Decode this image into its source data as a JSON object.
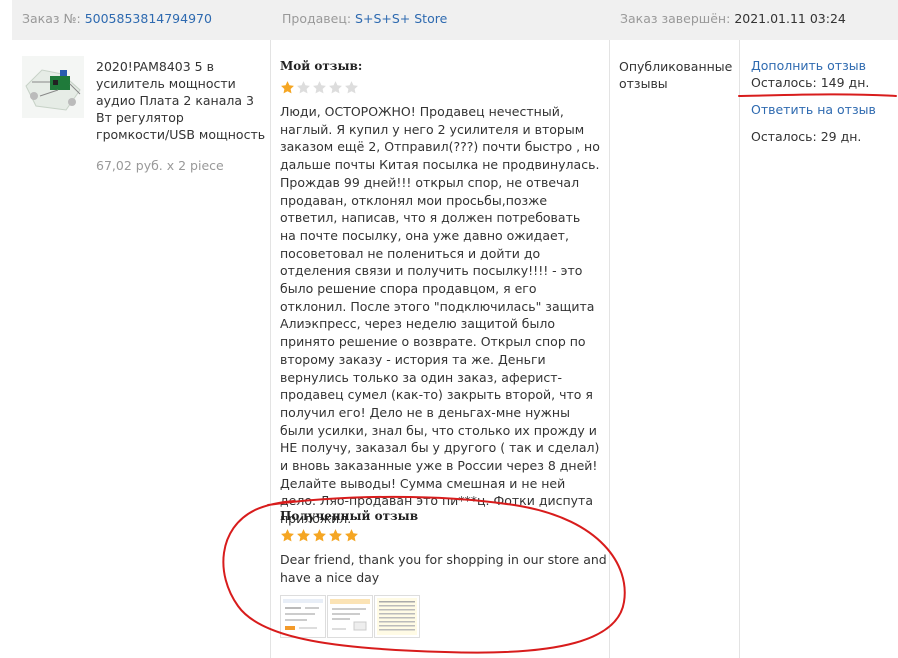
{
  "header": {
    "order_label": "Заказ №:",
    "order_number": "5005853814794970",
    "seller_label": "Продавец:",
    "seller_name": "S+S+S+ Store",
    "completed_label": "Заказ завершён:",
    "completed_date": "2021.01.11 03:24"
  },
  "product": {
    "title": "2020!PAM8403 5 в усилитель мощности аудио Плата 2 канала 3 Вт регулятор громкости/USB мощность",
    "price": "67,02 руб. x 2 piece"
  },
  "my_review": {
    "heading": "Мой отзыв:",
    "rating": 1,
    "max_rating": 5,
    "text": "Люди, ОСТОРОЖНО! Продавец нечестный, наглый. Я купил у него 2 усилителя и вторым заказом ещё 2, Отправил(???) почти быстро , но дальше почты Китая посылка не продвинулась. Прождав 99 дней!!! открыл спор, не отвечал продаван, отклонял мои просьбы,позже ответил, написав, что я должен потребовать на почте посылку, она уже давно ожидает, посоветовал не полениться и дойти до отделения связи и получить посылку!!!! - это было решение спора продавцом, я его отклонил. После этого \"подключилась\" защита Алиэкпресс, через неделю защитой было принято решение о возврате. Открыл спор по второму заказу - история та же. Деньги вернулись только за один заказ, аферист-продавец сумел (как-то) закрыть второй, что я получил его! Дело не в деньгах-мне нужны были усилки, знал бы, что столько их прожду и НЕ получу, заказал бы у другого ( так и сделал) и вновь заказанные уже в России через 8 дней! Делайте выводы! Сумма смешная и не ней дело. Ляо-продаван это пи***ц. Фотки диспута приложил."
  },
  "received_review": {
    "heading": "Полученный отзыв",
    "rating": 5,
    "max_rating": 5,
    "text": "Dear friend, thank you for shopping in our store and have a nice day"
  },
  "status": {
    "published_label": "Опубликованные отзывы"
  },
  "actions": {
    "add_review_label": "Дополнить отзыв",
    "add_review_remaining": "Осталось: 149 дн.",
    "reply_label": "Ответить на отзыв",
    "reply_remaining": "Осталось: 29 дн."
  },
  "colors": {
    "link": "#2e6ab0",
    "star_filled": "#f5a623",
    "star_empty": "#dddddd",
    "annotation": "#d81c1c",
    "header_bg": "#f0f0f0"
  }
}
